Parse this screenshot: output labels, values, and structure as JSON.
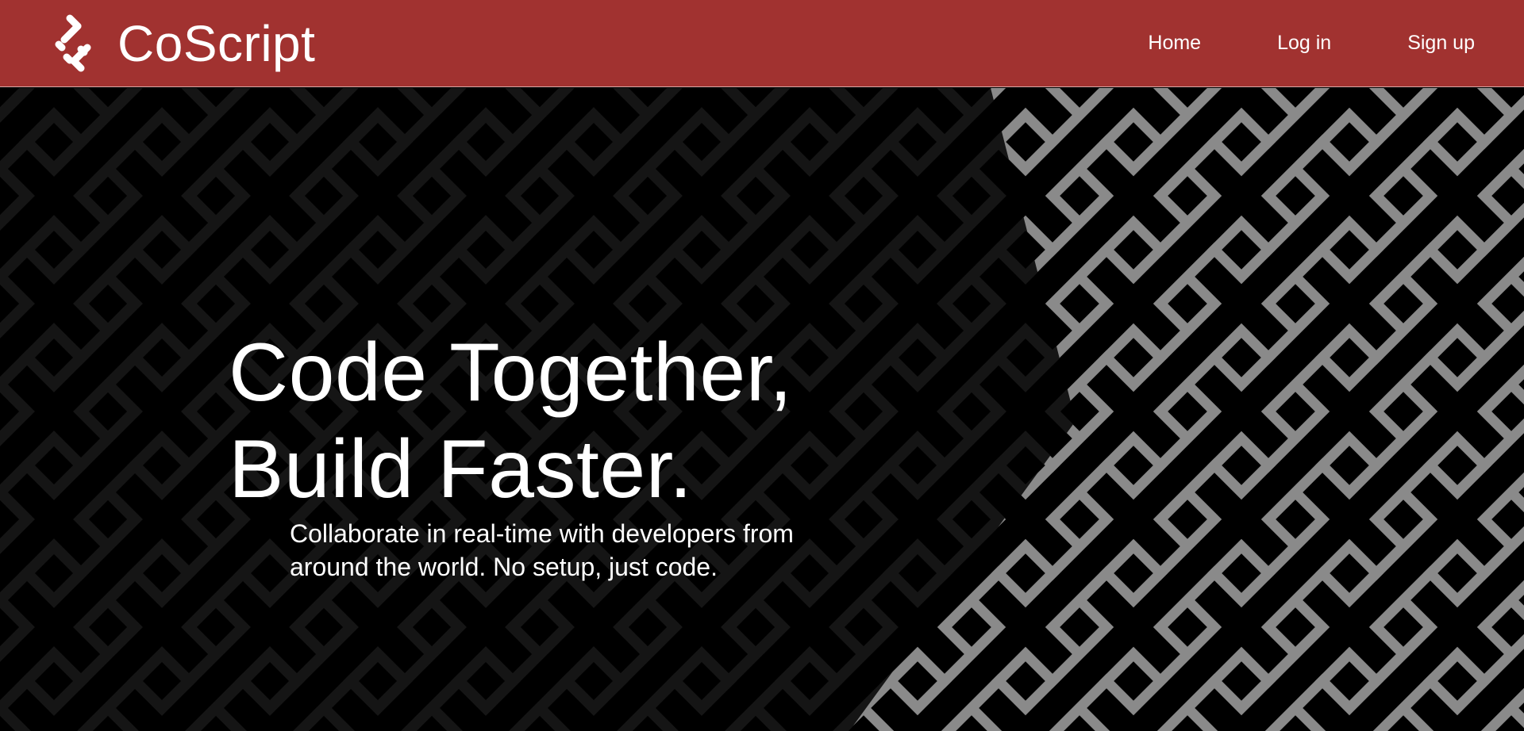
{
  "app": {
    "name": "CoScript"
  },
  "nav": {
    "home_label": "Home",
    "login_label": "Log in",
    "signup_label": "Sign up"
  },
  "hero": {
    "title_line1": "Code Together,",
    "title_line2": "Build Faster.",
    "subtitle": "Collaborate in real-time with developers from around the world. No setup, just code."
  },
  "icons": {
    "logo": "coscript-logo-icon",
    "background": "maze-pattern"
  },
  "colors": {
    "header": "#a13230",
    "hero_background": "#000000",
    "pattern_dark": "#161616",
    "pattern_light": "#8a8a8a",
    "text": "#ffffff"
  }
}
